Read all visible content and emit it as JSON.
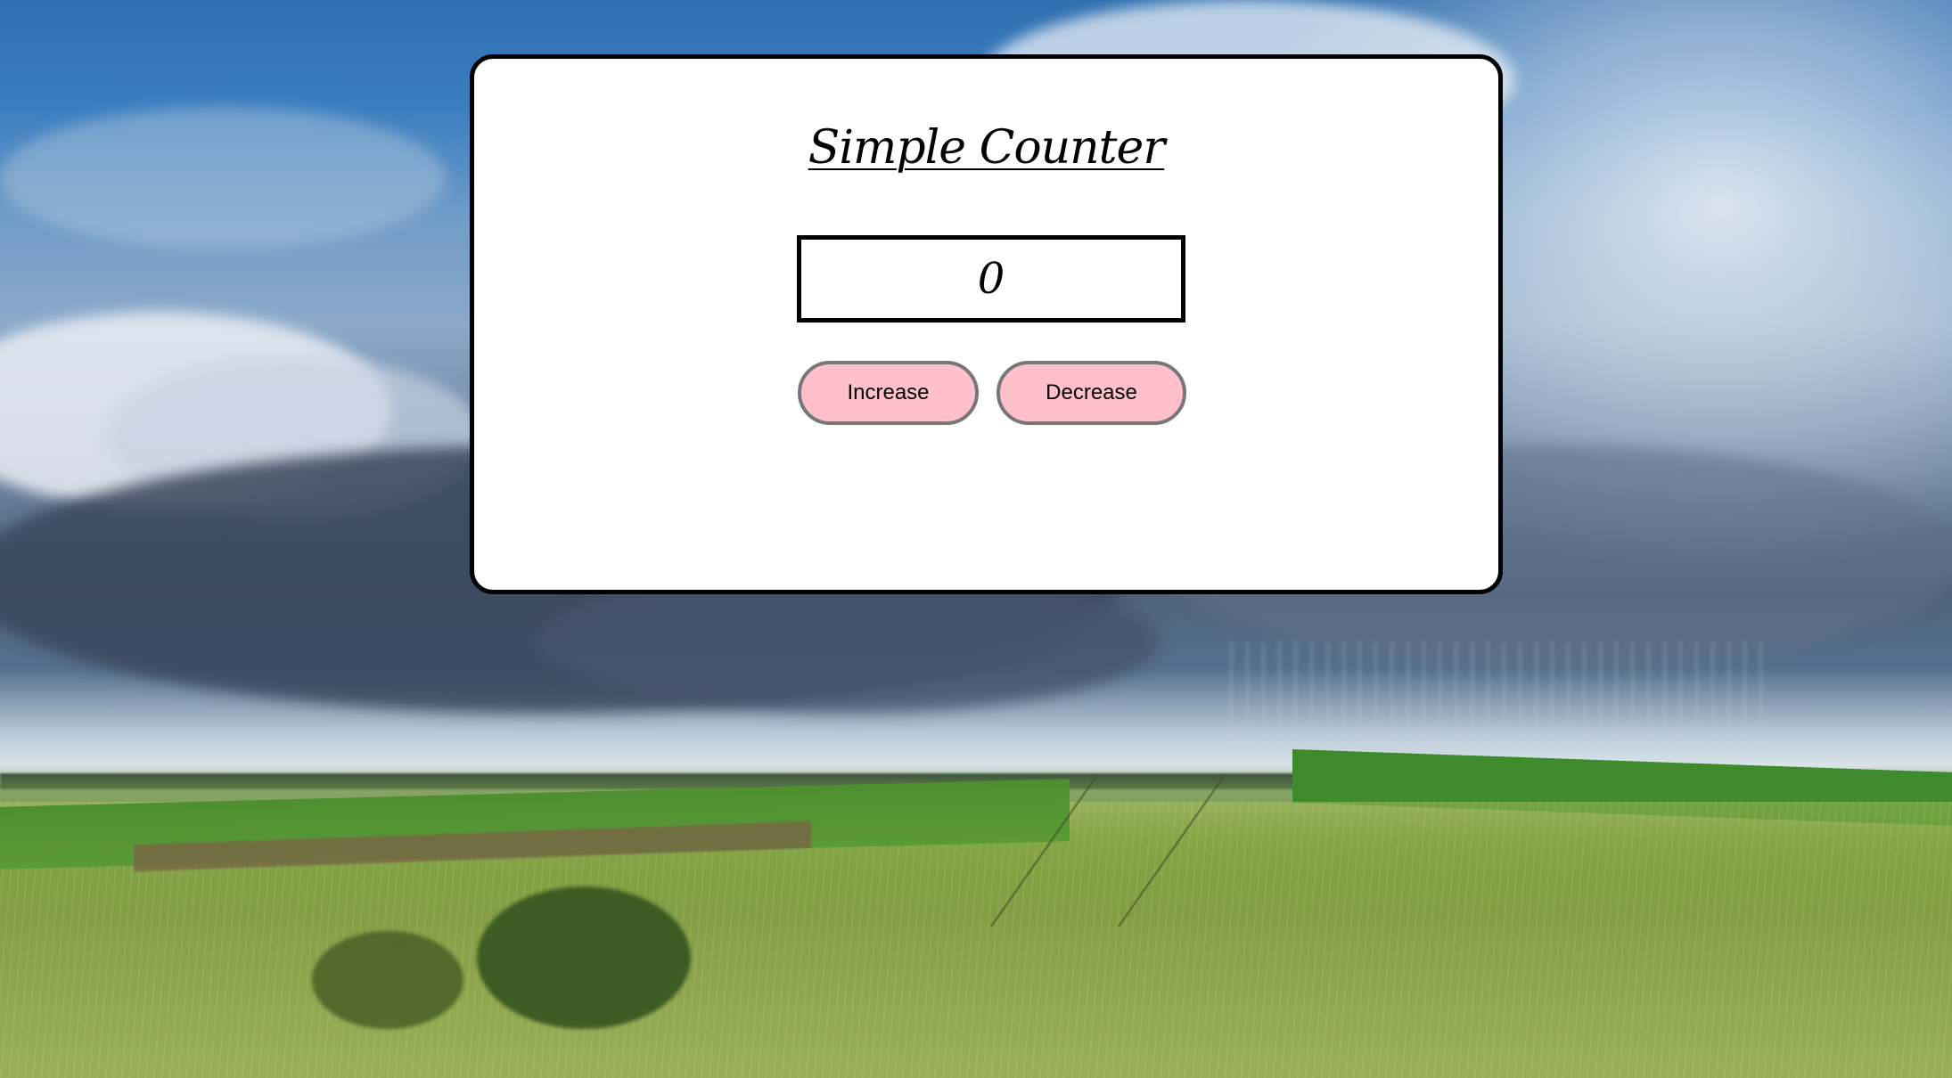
{
  "app": {
    "title": "Simple Counter"
  },
  "counter": {
    "value": "0"
  },
  "buttons": {
    "increase_label": "Increase",
    "decrease_label": "Decrease"
  },
  "colors": {
    "card_background": "#ffffff",
    "card_border": "#000000",
    "button_background": "#ffc0cb",
    "button_border": "#777777"
  },
  "background": {
    "scene": "stormy sky over green wheat field"
  }
}
